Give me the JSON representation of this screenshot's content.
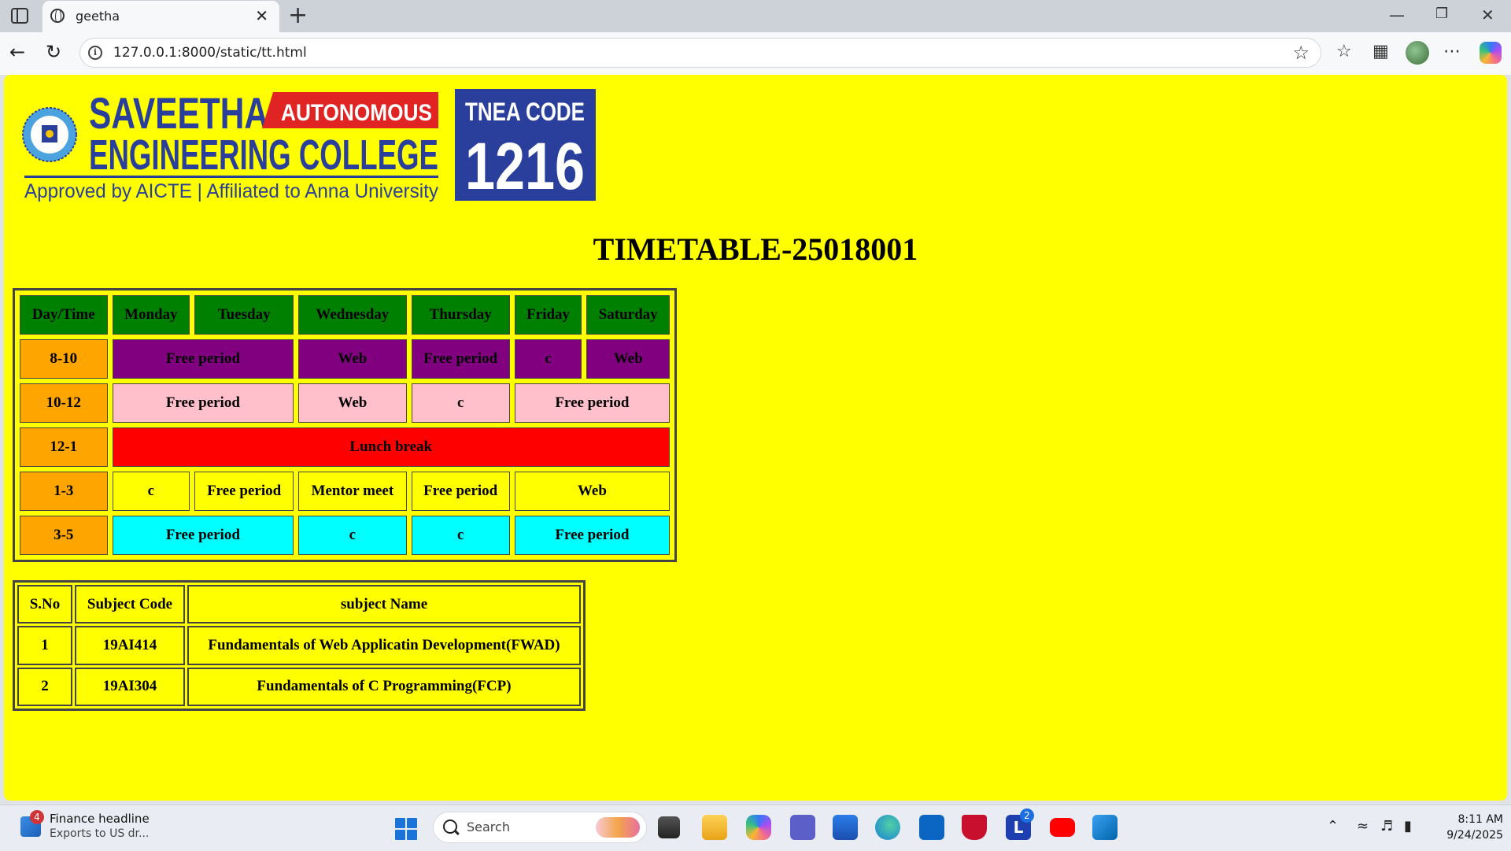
{
  "browser": {
    "tab_title": "geetha",
    "url": "127.0.0.1:8000/static/tt.html",
    "new_tab_symbol": "+",
    "close_symbol": "✕"
  },
  "logo": {
    "college_line1": "SAVEETHA",
    "autonomous": "AUTONOMOUS",
    "college_line2": "ENGINEERING COLLEGE",
    "tagline": "Approved by AICTE | Affiliated to Anna University",
    "tnea_label": "TNEA CODE",
    "tnea_code": "1216",
    "colors": {
      "navy": "#2a3f9b",
      "red": "#e02424"
    }
  },
  "page": {
    "title": "TIMETABLE-25018001",
    "background": "#ffff00"
  },
  "timetable": {
    "headers": [
      "Day/Time",
      "Monday",
      "Tuesday",
      "Wednesday",
      "Thursday",
      "Friday",
      "Saturday"
    ],
    "rows": [
      {
        "time": "8-10",
        "cells": [
          "Free period",
          "Web",
          "Free period",
          "c",
          "Web"
        ]
      },
      {
        "time": "10-12",
        "cells": [
          "Free period",
          "Web",
          "c",
          "Free period"
        ]
      },
      {
        "time": "12-1",
        "cells": [
          "Lunch break"
        ]
      },
      {
        "time": "1-3",
        "cells": [
          "c",
          "Free period",
          "Mentor meet",
          "Free period",
          "Web"
        ]
      },
      {
        "time": "3-5",
        "cells": [
          "Free period",
          "c",
          "c",
          "Free period"
        ]
      }
    ]
  },
  "subjects": {
    "headers": [
      "S.No",
      "Subject Code",
      "subject Name"
    ],
    "rows": [
      [
        "1",
        "19AI414",
        "Fundamentals of Web Applicatin Development(FWAD)"
      ],
      [
        "2",
        "19AI304",
        "Fundamentals of C Programming(FCP)"
      ]
    ]
  },
  "taskbar": {
    "news_badge": "4",
    "news_title": "Finance headline",
    "news_sub": "Exports to US dr...",
    "search_placeholder": "Search",
    "teams_badge": "2",
    "time": "8:11 AM",
    "date": "9/24/2025"
  }
}
